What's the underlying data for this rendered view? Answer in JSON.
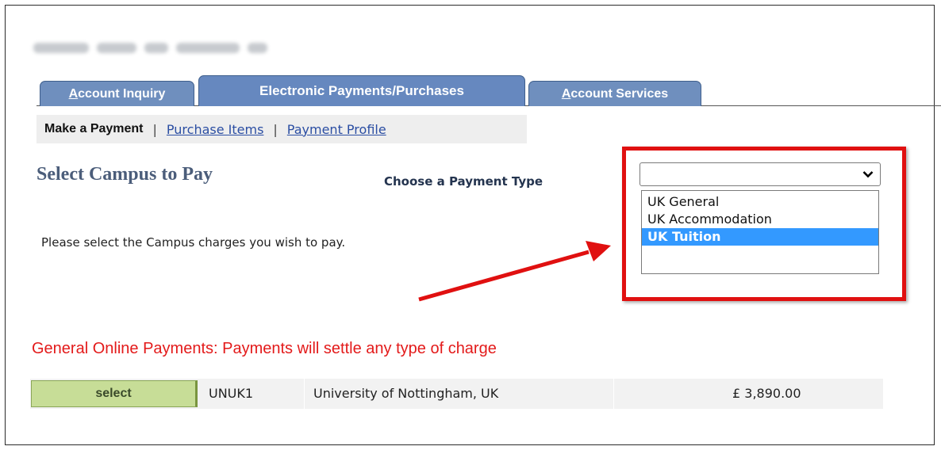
{
  "tabs": [
    {
      "prefix": "A",
      "rest": "ccount Inquiry"
    },
    {
      "label": "Electronic Payments/Purchases"
    },
    {
      "prefix": "A",
      "rest": "ccount Services"
    }
  ],
  "subnav": {
    "current": "Make a Payment",
    "links": [
      "Purchase Items",
      "Payment Profile"
    ]
  },
  "page_title": "Select Campus to Pay",
  "payment_type": {
    "label": "Choose a Payment Type",
    "selected_value": "",
    "options": [
      "UK General",
      "UK Accommodation",
      "UK Tuition"
    ],
    "highlighted": "UK Tuition"
  },
  "instruction": "Please select the Campus charges you wish to pay.",
  "general_heading": "General Online Payments: Payments will settle any type of charge",
  "campus_rows": [
    {
      "button": "select",
      "code": "UNUK1",
      "name": "University of Nottingham, UK",
      "amount": "£ 3,890.00"
    }
  ],
  "annotation_color": "#e01010"
}
